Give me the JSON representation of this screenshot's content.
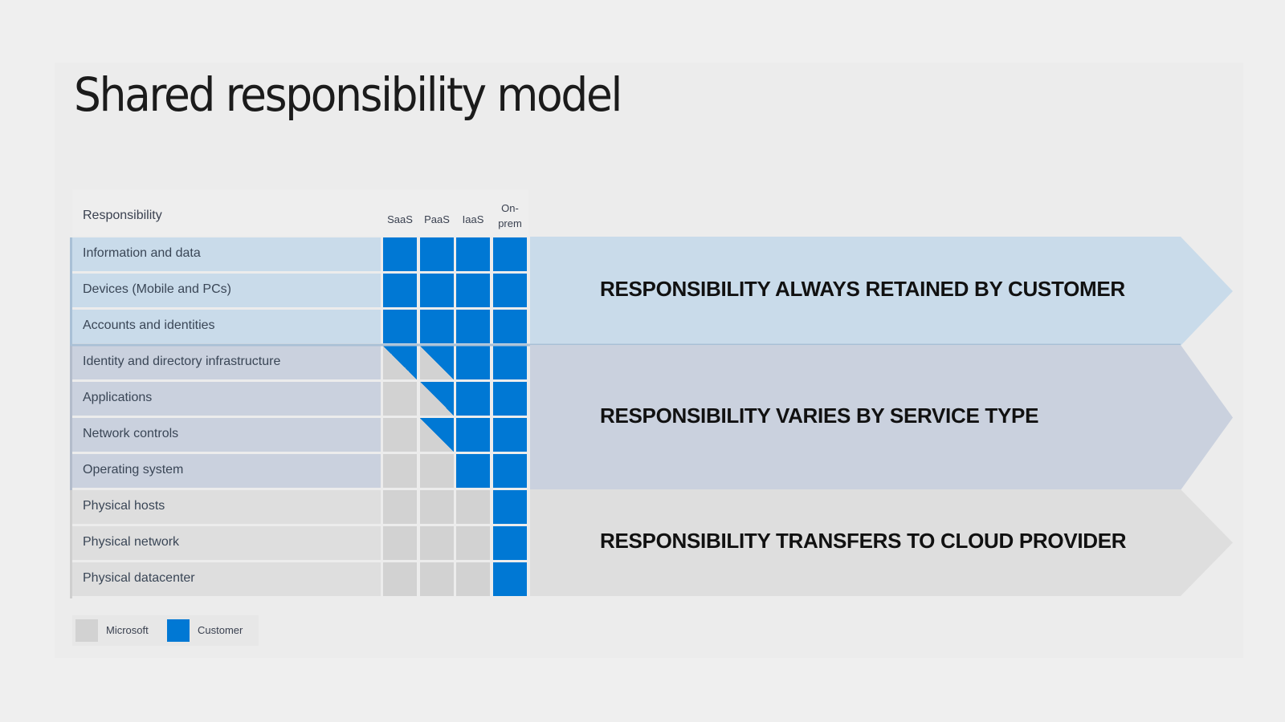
{
  "title": "Shared responsibility model",
  "table": {
    "header": "Responsibility",
    "columns": [
      {
        "label_line1": "",
        "label_line2": "SaaS"
      },
      {
        "label_line1": "",
        "label_line2": "PaaS"
      },
      {
        "label_line1": "",
        "label_line2": "IaaS"
      },
      {
        "label_line1": "On-",
        "label_line2": "prem"
      }
    ],
    "rows": [
      {
        "label": "Information and data",
        "group": "customer",
        "cells": [
          "customer",
          "customer",
          "customer",
          "customer"
        ]
      },
      {
        "label": "Devices (Mobile and PCs)",
        "group": "customer",
        "cells": [
          "customer",
          "customer",
          "customer",
          "customer"
        ]
      },
      {
        "label": "Accounts and identities",
        "group": "customer",
        "cells": [
          "customer",
          "customer",
          "customer",
          "customer"
        ]
      },
      {
        "label": "Identity and directory infrastructure",
        "group": "varies",
        "cells": [
          "shared",
          "shared",
          "customer",
          "customer"
        ]
      },
      {
        "label": "Applications",
        "group": "varies",
        "cells": [
          "microsoft",
          "shared",
          "customer",
          "customer"
        ]
      },
      {
        "label": "Network controls",
        "group": "varies",
        "cells": [
          "microsoft",
          "shared",
          "customer",
          "customer"
        ]
      },
      {
        "label": "Operating system",
        "group": "varies",
        "cells": [
          "microsoft",
          "microsoft",
          "customer",
          "customer"
        ]
      },
      {
        "label": "Physical hosts",
        "group": "provider",
        "cells": [
          "microsoft",
          "microsoft",
          "microsoft",
          "customer"
        ]
      },
      {
        "label": "Physical network",
        "group": "provider",
        "cells": [
          "microsoft",
          "microsoft",
          "microsoft",
          "customer"
        ]
      },
      {
        "label": "Physical datacenter",
        "group": "provider",
        "cells": [
          "microsoft",
          "microsoft",
          "microsoft",
          "customer"
        ]
      }
    ]
  },
  "bands": [
    {
      "text": "RESPONSIBILITY ALWAYS RETAINED BY CUSTOMER",
      "group": "customer"
    },
    {
      "text": "RESPONSIBILITY VARIES BY SERVICE TYPE",
      "group": "varies"
    },
    {
      "text": "RESPONSIBILITY TRANSFERS TO CLOUD PROVIDER",
      "group": "provider"
    }
  ],
  "legend": [
    {
      "label": "Microsoft",
      "key": "microsoft"
    },
    {
      "label": "Customer",
      "key": "customer"
    }
  ],
  "colors": {
    "customer": "#0078d4",
    "microsoft": "#d2d2d2",
    "group_customer": "#c9dbea",
    "group_varies": "#cad1de",
    "group_provider": "#dedede"
  }
}
